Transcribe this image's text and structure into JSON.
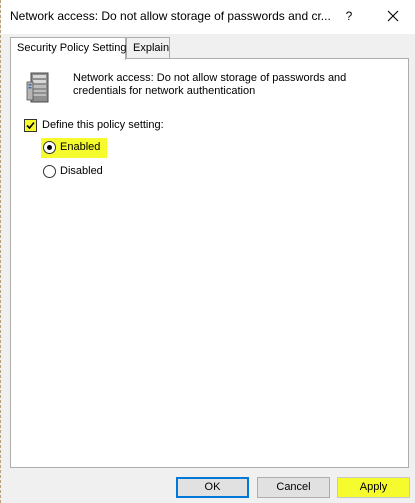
{
  "window": {
    "title": "Network access: Do not allow storage of passwords and cr...",
    "help_label": "?",
    "close_icon": "close-icon"
  },
  "tabs": [
    {
      "label": "Security Policy Setting",
      "active": true
    },
    {
      "label": "Explain",
      "active": false
    }
  ],
  "policy": {
    "icon": "server-icon",
    "description": "Network access: Do not allow storage of passwords and credentials for network authentication"
  },
  "define_setting": {
    "label": "Define this policy setting:",
    "checked": true
  },
  "options": [
    {
      "label": "Enabled",
      "selected": true
    },
    {
      "label": "Disabled",
      "selected": false
    }
  ],
  "buttons": {
    "ok": "OK",
    "cancel": "Cancel",
    "apply": "Apply"
  },
  "colors": {
    "highlight": "#f6fb2d",
    "focus_border": "#0078d7",
    "panel_background": "#ffffff",
    "dialog_background": "#f0f0f0"
  }
}
